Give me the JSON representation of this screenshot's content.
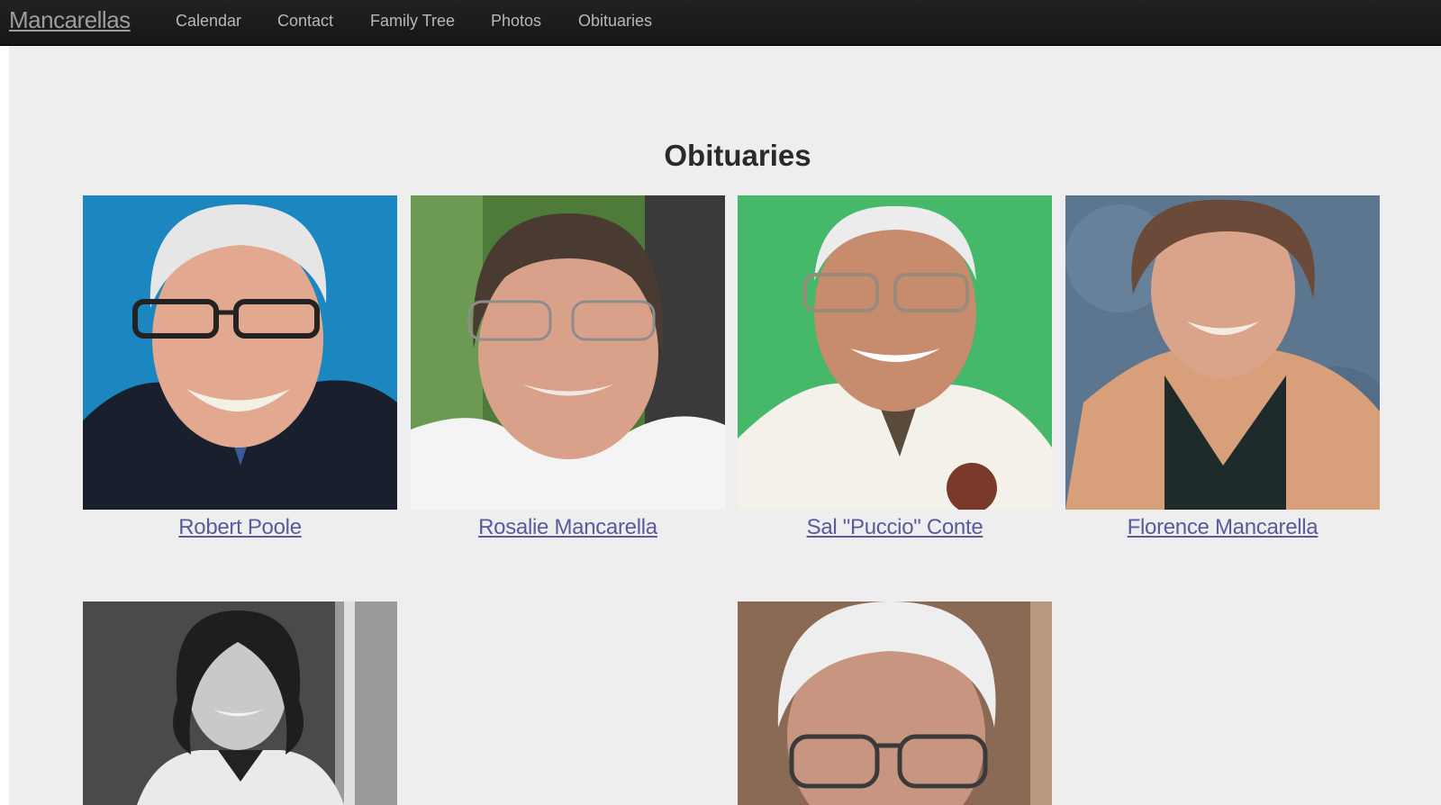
{
  "navbar": {
    "brand": "Mancarellas",
    "links": [
      "Calendar",
      "Contact",
      "Family Tree",
      "Photos",
      "Obituaries"
    ]
  },
  "main": {
    "title": "Obituaries",
    "obituaries": [
      {
        "name": "Robert Poole"
      },
      {
        "name": "Rosalie Mancarella"
      },
      {
        "name": "Sal \"Puccio\" Conte"
      },
      {
        "name": "Florence Mancarella"
      }
    ]
  },
  "colors": {
    "navbar_bg": "#1b1b1b",
    "page_bg": "#eeeeee",
    "link": "#5a5a9c"
  }
}
